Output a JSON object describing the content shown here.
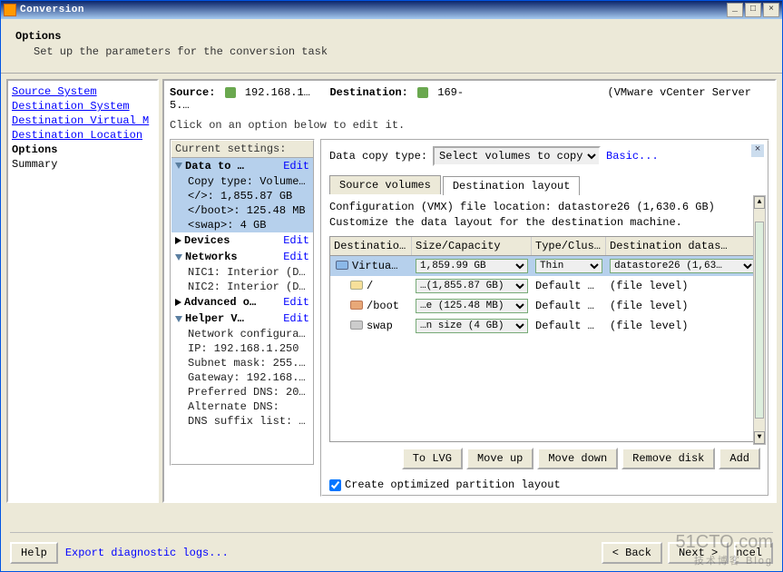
{
  "window": {
    "title": "Conversion"
  },
  "wizard": {
    "title": "Options",
    "subtitle": "Set up the parameters for the conversion task"
  },
  "nav": {
    "items": [
      "Source System",
      "Destination System",
      "Destination Virtual M",
      "Destination Location"
    ],
    "current": "Options",
    "after": "Summary"
  },
  "source": {
    "label": "Source:",
    "value": "192.168.1…",
    "dest_label": "Destination:",
    "dest_value": "169-",
    "server": "(VMware vCenter Server 5.…"
  },
  "instr": "Click on an option below to edit it.",
  "settings": {
    "header": "Current settings:",
    "data_to": {
      "label": "Data to …",
      "edit": "Edit",
      "copy_type": "Copy type: Volume…",
      "root": "</>: 1,855.87 GB",
      "boot": "</boot>: 125.48 MB",
      "swap": "<swap>: 4 GB"
    },
    "devices": {
      "label": "Devices",
      "edit": "Edit"
    },
    "networks": {
      "label": "Networks",
      "edit": "Edit",
      "nic1": "NIC1: Interior (D…",
      "nic2": "NIC2: Interior (D…"
    },
    "advanced": {
      "label": "Advanced o…",
      "edit": "Edit"
    },
    "helper": {
      "label": "Helper V…",
      "edit": "Edit",
      "lines": [
        "Network configura…",
        "IP: 192.168.1.250",
        "Subnet mask: 255.…",
        "Gateway: 192.168.…",
        "Preferred DNS: 20…",
        "Alternate DNS:",
        "DNS suffix list: …"
      ]
    }
  },
  "detail": {
    "dct_label": "Data copy type:",
    "dct_value": "Select volumes to copy",
    "basic": "Basic...",
    "tab1": "Source volumes",
    "tab2": "Destination layout",
    "conf1": "Configuration (VMX) file location: datastore26 (1,630.6 GB)",
    "conf2": "Customize the data layout for the destination machine.",
    "cols": {
      "c1": "Destinatio…",
      "c2": "Size/Capacity",
      "c3": "Type/Clus…",
      "c4": "Destination datas…"
    },
    "rows": [
      {
        "name": "Virtua…",
        "size": "1,859.99 GB",
        "type": "Thin",
        "ds": "datastore26 (1,63…",
        "indent": 0,
        "sel": true,
        "icon": "blue",
        "combo": true
      },
      {
        "name": "/",
        "size": "…(1,855.87 GB)",
        "type": "Default …",
        "ds": "(file level)",
        "indent": 1,
        "icon": "yellow",
        "combo": true
      },
      {
        "name": "/boot",
        "size": "…e (125.48 MB)",
        "type": "Default …",
        "ds": "(file level)",
        "indent": 1,
        "icon": "red",
        "combo": true
      },
      {
        "name": "swap",
        "size": "…n size (4 GB)",
        "type": "Default …",
        "ds": "(file level)",
        "indent": 1,
        "icon": "gray",
        "combo": true
      }
    ],
    "btns": {
      "lvg": "To LVG",
      "up": "Move up",
      "down": "Move down",
      "remove": "Remove disk",
      "add": "Add"
    },
    "opt_check": "Create optimized partition layout"
  },
  "footer": {
    "help": "Help",
    "export": "Export diagnostic logs...",
    "back": "< Back",
    "next": "Next >",
    "cancel": "ncel"
  },
  "watermark": {
    "main": "51CTO.com",
    "sub": "技术博客 Blog"
  }
}
